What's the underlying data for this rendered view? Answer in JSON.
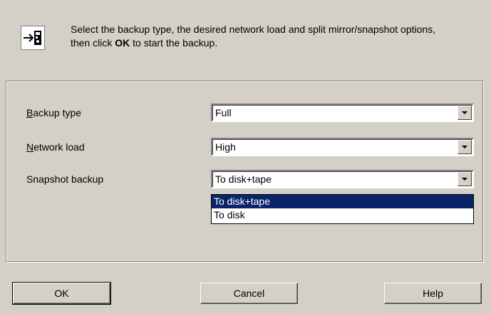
{
  "header": {
    "text_before": "Select the backup type, the desired network load and split mirror/snapshot options, then click ",
    "bold_word": "OK",
    "text_after": " to start the backup."
  },
  "fields": {
    "backup_type": {
      "label_accel": "B",
      "label_rest": "ackup type",
      "value": "Full"
    },
    "network_load": {
      "label_accel": "N",
      "label_rest": "etwork load",
      "value": "High"
    },
    "snapshot_backup": {
      "label": "Snapshot backup",
      "value": "To disk+tape"
    }
  },
  "dropdown": {
    "options": [
      "To disk+tape",
      "To disk"
    ],
    "selected_index": 0
  },
  "buttons": {
    "ok": "OK",
    "cancel": "Cancel",
    "help": "Help"
  },
  "icons": {
    "header": "backup-arrow-icon"
  }
}
